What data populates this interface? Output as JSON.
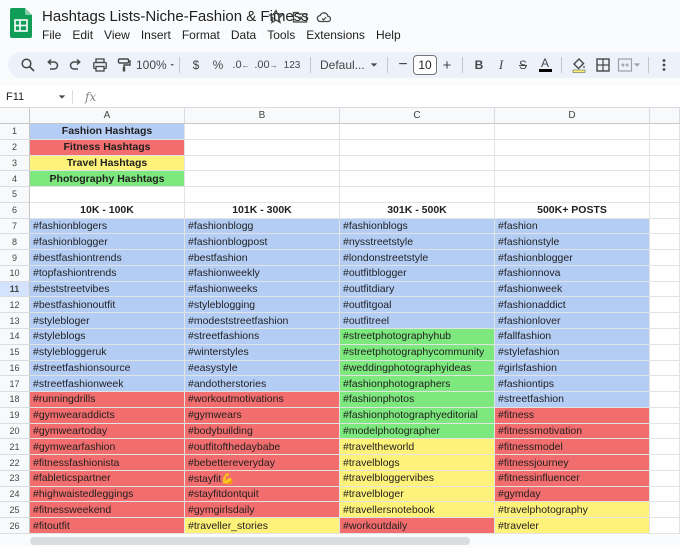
{
  "app": {
    "title": "Hashtags Lists-Niche-Fashion & Fitness",
    "menu": [
      "File",
      "Edit",
      "View",
      "Insert",
      "Format",
      "Data",
      "Tools",
      "Extensions",
      "Help"
    ]
  },
  "toolbar": {
    "zoom": "100%",
    "currency": "$",
    "percent": "%",
    "decrease_decimal": ".0",
    "increase_decimal": ".00",
    "number_format": "123",
    "font": "Defaul...",
    "font_size": "10",
    "minus": "−",
    "plus": "+",
    "bold": "B",
    "italic": "I",
    "strike": "S",
    "text_color": "A"
  },
  "formula_bar": {
    "cell_ref": "F11",
    "fx": "fx"
  },
  "colors": {
    "blue": "#b4cdf5",
    "red": "#f26d6d",
    "yellow": "#fff27a",
    "green": "#7de87d",
    "white": "#ffffff"
  },
  "columns": [
    "A",
    "B",
    "C",
    "D"
  ],
  "rows": [
    {
      "n": "1",
      "cells": [
        {
          "t": "Fashion Hashtags",
          "c": "blue",
          "s": "center"
        },
        {
          "t": "",
          "c": "white"
        },
        {
          "t": "",
          "c": "white"
        },
        {
          "t": "",
          "c": "white"
        }
      ]
    },
    {
      "n": "2",
      "cells": [
        {
          "t": "Fitness Hashtags",
          "c": "red",
          "s": "center"
        },
        {
          "t": "",
          "c": "white"
        },
        {
          "t": "",
          "c": "white"
        },
        {
          "t": "",
          "c": "white"
        }
      ]
    },
    {
      "n": "3",
      "cells": [
        {
          "t": "Travel Hashtags",
          "c": "yellow",
          "s": "center"
        },
        {
          "t": "",
          "c": "white"
        },
        {
          "t": "",
          "c": "white"
        },
        {
          "t": "",
          "c": "white"
        }
      ]
    },
    {
      "n": "4",
      "cells": [
        {
          "t": "Photography Hashtags",
          "c": "green",
          "s": "center"
        },
        {
          "t": "",
          "c": "white"
        },
        {
          "t": "",
          "c": "white"
        },
        {
          "t": "",
          "c": "white"
        }
      ]
    },
    {
      "n": "5",
      "cells": [
        {
          "t": "",
          "c": "white"
        },
        {
          "t": "",
          "c": "white"
        },
        {
          "t": "",
          "c": "white"
        },
        {
          "t": "",
          "c": "white"
        }
      ]
    },
    {
      "n": "6",
      "cells": [
        {
          "t": "10K - 100K",
          "c": "white",
          "s": "center"
        },
        {
          "t": "101K - 300K",
          "c": "white",
          "s": "center"
        },
        {
          "t": "301K - 500K",
          "c": "white",
          "s": "center"
        },
        {
          "t": "500K+ POSTS",
          "c": "white",
          "s": "center"
        }
      ]
    },
    {
      "n": "7",
      "cells": [
        {
          "t": "#fashionblogers",
          "c": "blue"
        },
        {
          "t": "#fashionblogg",
          "c": "blue"
        },
        {
          "t": "#fashionblogs",
          "c": "blue"
        },
        {
          "t": "#fashion",
          "c": "blue"
        }
      ]
    },
    {
      "n": "8",
      "cells": [
        {
          "t": "#fashionblogger",
          "c": "blue"
        },
        {
          "t": "#fashionblogpost",
          "c": "blue"
        },
        {
          "t": "#nysstreetstyle",
          "c": "blue"
        },
        {
          "t": "#fashionstyle",
          "c": "blue"
        }
      ]
    },
    {
      "n": "9",
      "cells": [
        {
          "t": "#bestfashiontrends",
          "c": "blue"
        },
        {
          "t": "#bestfashion",
          "c": "blue"
        },
        {
          "t": "#londonstreetstyle",
          "c": "blue"
        },
        {
          "t": "#fashionblogger",
          "c": "blue"
        }
      ]
    },
    {
      "n": "10",
      "cells": [
        {
          "t": "#topfashiontrends",
          "c": "blue"
        },
        {
          "t": "#fashionweekly",
          "c": "blue"
        },
        {
          "t": "#outfitblogger",
          "c": "blue"
        },
        {
          "t": "#fashionnova",
          "c": "blue"
        }
      ]
    },
    {
      "n": "11",
      "cells": [
        {
          "t": "#beststreetvibes",
          "c": "blue"
        },
        {
          "t": "#fashionweeks",
          "c": "blue"
        },
        {
          "t": "#outfitdiary",
          "c": "blue"
        },
        {
          "t": "#fashionweek",
          "c": "blue"
        }
      ]
    },
    {
      "n": "12",
      "cells": [
        {
          "t": "#bestfashionoutfit",
          "c": "blue"
        },
        {
          "t": "#styleblogging",
          "c": "blue"
        },
        {
          "t": "#outfitgoal",
          "c": "blue"
        },
        {
          "t": "#fashionaddict",
          "c": "blue"
        }
      ]
    },
    {
      "n": "13",
      "cells": [
        {
          "t": "#stylebloger",
          "c": "blue"
        },
        {
          "t": "#modeststreetfashion",
          "c": "blue"
        },
        {
          "t": "#outfitreel",
          "c": "blue"
        },
        {
          "t": "#fashionlover",
          "c": "blue"
        }
      ]
    },
    {
      "n": "14",
      "cells": [
        {
          "t": "#styleblogs",
          "c": "blue"
        },
        {
          "t": "#streetfashions",
          "c": "blue"
        },
        {
          "t": "#streetphotographyhub",
          "c": "green"
        },
        {
          "t": "#fallfashion",
          "c": "blue"
        }
      ]
    },
    {
      "n": "15",
      "cells": [
        {
          "t": "#stylebloggeruk",
          "c": "blue"
        },
        {
          "t": "#winterstyles",
          "c": "blue"
        },
        {
          "t": "#streetphotographycommunity",
          "c": "green"
        },
        {
          "t": "#stylefashion",
          "c": "blue"
        }
      ]
    },
    {
      "n": "16",
      "cells": [
        {
          "t": "#streetfashionsource",
          "c": "blue"
        },
        {
          "t": "#easystyle",
          "c": "blue"
        },
        {
          "t": "#weddingphotographyideas",
          "c": "green"
        },
        {
          "t": "#girlsfashion",
          "c": "blue"
        }
      ]
    },
    {
      "n": "17",
      "cells": [
        {
          "t": "#streetfashionweek",
          "c": "blue"
        },
        {
          "t": "#andotherstories",
          "c": "blue"
        },
        {
          "t": "#fashionphotographers",
          "c": "green"
        },
        {
          "t": "#fashiontips",
          "c": "blue"
        }
      ]
    },
    {
      "n": "18",
      "cells": [
        {
          "t": "#runningdrills",
          "c": "red"
        },
        {
          "t": "#workoutmotivations",
          "c": "red"
        },
        {
          "t": "#fashionphotos",
          "c": "green"
        },
        {
          "t": "#streetfashion",
          "c": "blue"
        }
      ]
    },
    {
      "n": "19",
      "cells": [
        {
          "t": "#gymwearaddicts",
          "c": "red"
        },
        {
          "t": "#gymwears",
          "c": "red"
        },
        {
          "t": "#fashionphotographyeditorial",
          "c": "green"
        },
        {
          "t": "#fitness",
          "c": "red"
        }
      ]
    },
    {
      "n": "20",
      "cells": [
        {
          "t": "#gymweartoday",
          "c": "red"
        },
        {
          "t": "#bodybuilding",
          "c": "red"
        },
        {
          "t": "#modelphotographer",
          "c": "green"
        },
        {
          "t": "#fitnessmotivation",
          "c": "red"
        }
      ]
    },
    {
      "n": "21",
      "cells": [
        {
          "t": "#gymwearfashion",
          "c": "red"
        },
        {
          "t": "#outfitofthedaybabe",
          "c": "red"
        },
        {
          "t": "#traveltheworld",
          "c": "yellow"
        },
        {
          "t": "#fitnessmodel",
          "c": "red"
        }
      ]
    },
    {
      "n": "22",
      "cells": [
        {
          "t": "#fitnessfashionista",
          "c": "red"
        },
        {
          "t": "#bebettereveryday",
          "c": "red"
        },
        {
          "t": "#travelblogs",
          "c": "yellow"
        },
        {
          "t": "#fitnessjourney",
          "c": "red"
        }
      ]
    },
    {
      "n": "23",
      "cells": [
        {
          "t": "#fableticspartner",
          "c": "red"
        },
        {
          "t": "#stayfit💪",
          "c": "red"
        },
        {
          "t": "#travelbloggervibes",
          "c": "yellow"
        },
        {
          "t": "#fitnessinfluencer",
          "c": "red"
        }
      ]
    },
    {
      "n": "24",
      "cells": [
        {
          "t": "#highwaistedleggings",
          "c": "red"
        },
        {
          "t": "#stayfitdontquit",
          "c": "red"
        },
        {
          "t": "#travelbloger",
          "c": "yellow"
        },
        {
          "t": "#gymday",
          "c": "red"
        }
      ]
    },
    {
      "n": "25",
      "cells": [
        {
          "t": "#fitnessweekend",
          "c": "red"
        },
        {
          "t": "#gymgirlsdaily",
          "c": "red"
        },
        {
          "t": "#travellersnotebook",
          "c": "yellow"
        },
        {
          "t": "#travelphotography",
          "c": "yellow"
        }
      ]
    },
    {
      "n": "26",
      "cells": [
        {
          "t": "#fitoutfit",
          "c": "red"
        },
        {
          "t": "#traveller_stories",
          "c": "yellow"
        },
        {
          "t": "#workoutdaily",
          "c": "red"
        },
        {
          "t": "#traveler",
          "c": "yellow"
        }
      ]
    }
  ]
}
